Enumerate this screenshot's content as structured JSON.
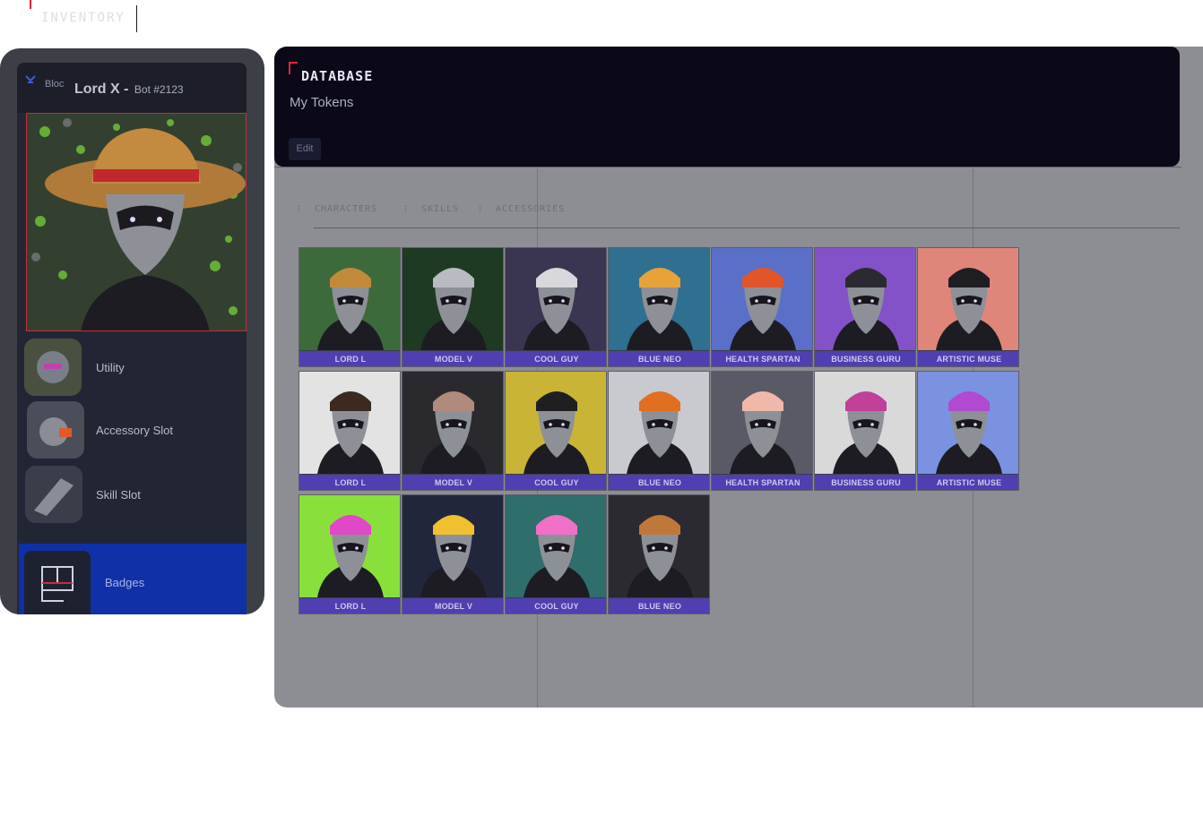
{
  "brand": {
    "title": "INVENTORY"
  },
  "profile": {
    "org": "Bloc",
    "name": "Lord X -",
    "bot_id": "Bot #2123",
    "slots": [
      {
        "label": "Utility"
      },
      {
        "label": "Accessory Slot"
      },
      {
        "label": "Skill Slot"
      }
    ],
    "badges_label": "Badges"
  },
  "database": {
    "title": "DATABASE",
    "subtitle": "My Tokens",
    "edit_label": "Edit"
  },
  "tabs": [
    {
      "label": "CHARACTERS"
    },
    {
      "label": "SKILLS"
    },
    {
      "label": "ACCESSORIES"
    }
  ],
  "tokens": [
    {
      "name": "LORD L",
      "bg": "#3d6a3a",
      "accent": "#c08a3a"
    },
    {
      "name": "MODEL V",
      "bg": "#1e3a22",
      "accent": "#b9bbc2"
    },
    {
      "name": "COOL GUY",
      "bg": "#3a3550",
      "accent": "#d8d8dc"
    },
    {
      "name": "BLUE NEO",
      "bg": "#2f6f8f",
      "accent": "#e8a23a"
    },
    {
      "name": "HEALTH SPARTAN",
      "bg": "#5a6fc8",
      "accent": "#e0562a"
    },
    {
      "name": "BUSINESS GURU",
      "bg": "#8452c8",
      "accent": "#2a2a30"
    },
    {
      "name": "ARTISTIC MUSE",
      "bg": "#e0857a",
      "accent": "#1e1e22"
    },
    {
      "name": "LORD L",
      "bg": "#e3e3e3",
      "accent": "#3a2a20"
    },
    {
      "name": "MODEL V",
      "bg": "#2a2a2e",
      "accent": "#b08a7a"
    },
    {
      "name": "COOL GUY",
      "bg": "#c9b436",
      "accent": "#1f1f22"
    },
    {
      "name": "BLUE NEO",
      "bg": "#c9cacf",
      "accent": "#e07020"
    },
    {
      "name": "HEALTH SPARTAN",
      "bg": "#5a5a66",
      "accent": "#f0b8a8"
    },
    {
      "name": "BUSINESS GURU",
      "bg": "#d9d9d9",
      "accent": "#c0409a"
    },
    {
      "name": "ARTISTIC MUSE",
      "bg": "#7a92e0",
      "accent": "#b04ad0"
    },
    {
      "name": "LORD L",
      "bg": "#8ae03a",
      "accent": "#e048c8"
    },
    {
      "name": "MODEL V",
      "bg": "#22263a",
      "accent": "#f0c030"
    },
    {
      "name": "COOL GUY",
      "bg": "#2f6e6a",
      "accent": "#f070c8"
    },
    {
      "name": "BLUE NEO",
      "bg": "#2a2a30",
      "accent": "#c0783a"
    }
  ]
}
